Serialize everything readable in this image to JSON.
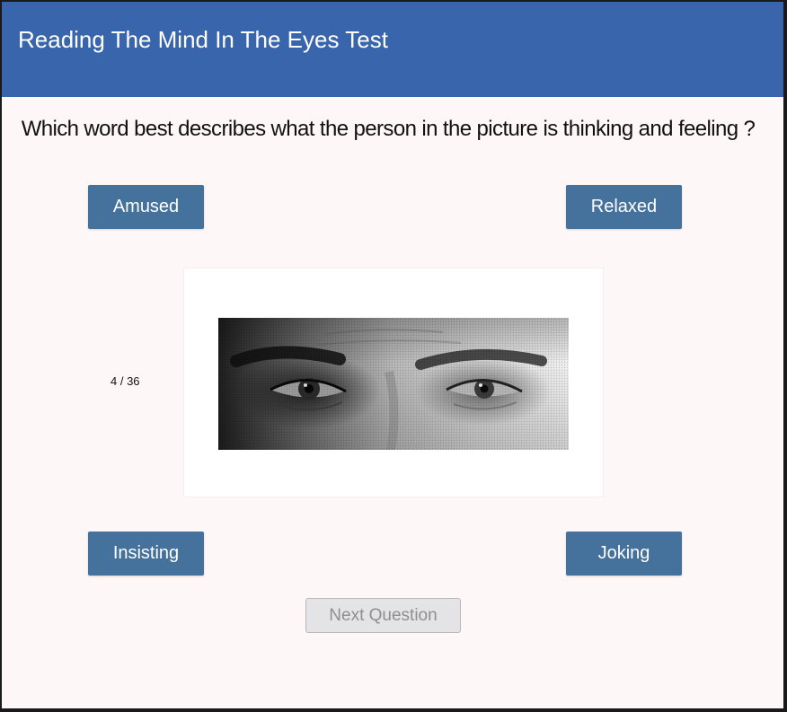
{
  "app": {
    "title": "Reading The Mind In The Eyes Test"
  },
  "quiz": {
    "question": "Which word best describes what the person in the picture is thinking and feeling ?",
    "counter": "4 / 36",
    "options": {
      "top_left": "Amused",
      "top_right": "Relaxed",
      "bottom_left": "Insisting",
      "bottom_right": "Joking"
    },
    "next_label": "Next Question",
    "next_enabled": false
  },
  "colors": {
    "header": "#3865ab",
    "answer_button": "#44729d",
    "background": "#fdf7f8",
    "disabled_button": "#e4e4e6"
  }
}
